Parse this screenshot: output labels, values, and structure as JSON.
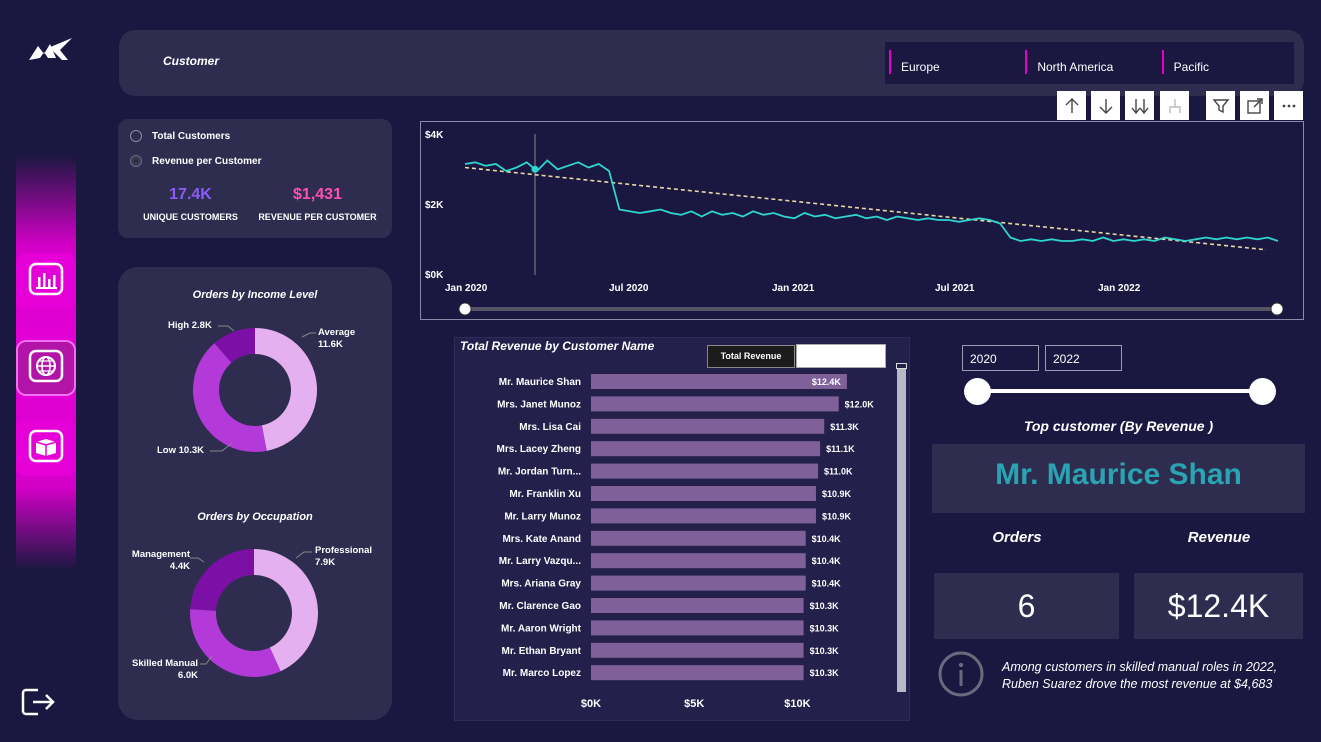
{
  "header": {
    "title": "Customer"
  },
  "region_slicer": {
    "items": [
      "Europe",
      "North America",
      "Pacific"
    ]
  },
  "kpi": {
    "options": [
      "Total Customers",
      "Revenue per Customer"
    ],
    "selected_option": "Revenue per Customer",
    "unique_customers_value": "17.4K",
    "unique_customers_label": "UNIQUE CUSTOMERS",
    "revenue_per_customer_value": "$1,431",
    "revenue_per_customer_label": "REVENUE PER CUSTOMER",
    "unique_color": "#8b5cf6",
    "revenue_color": "#ff4fb4"
  },
  "line_chart": {
    "y_ticks": [
      "$4K",
      "$2K",
      "$0K"
    ],
    "x_ticks": [
      "Jan 2020",
      "Jul 2020",
      "Jan 2021",
      "Jul 2021",
      "Jan 2022"
    ],
    "line_color": "#2fd5cf",
    "trend_color": "#e7d8a4"
  },
  "donut_income": {
    "title": "Orders by Income Level",
    "labels": [
      {
        "name": "Average",
        "value": "11.6K"
      },
      {
        "name": "Low",
        "value": "10.3K"
      },
      {
        "name": "High",
        "value": "2.8K"
      }
    ],
    "colors": [
      "#e4b0f0",
      "#b339d9",
      "#7b0fa6"
    ]
  },
  "donut_occupation": {
    "title": "Orders by Occupation",
    "labels": [
      {
        "name": "Professional",
        "value": "7.9K"
      },
      {
        "name": "Skilled Manual",
        "value": "6.0K"
      },
      {
        "name": "Management",
        "value": "4.4K"
      }
    ],
    "colors": [
      "#e4b0f0",
      "#b339d9",
      "#7b0fa6"
    ]
  },
  "bar_chart": {
    "title": "Total Revenue by Customer Name",
    "legend_button": "Total Revenue",
    "x_ticks": [
      "$0K",
      "$5K",
      "$10K"
    ],
    "bar_color": "#7f6099",
    "rows": [
      {
        "name": "Mr. Maurice Shan",
        "label": "$12.4K"
      },
      {
        "name": "Mrs. Janet Munoz",
        "label": "$12.0K"
      },
      {
        "name": "Mrs. Lisa Cai",
        "label": "$11.3K"
      },
      {
        "name": "Mrs. Lacey Zheng",
        "label": "$11.1K"
      },
      {
        "name": "Mr. Jordan Turn...",
        "label": "$11.0K"
      },
      {
        "name": "Mr. Franklin Xu",
        "label": "$10.9K"
      },
      {
        "name": "Mr. Larry Munoz",
        "label": "$10.9K"
      },
      {
        "name": "Mrs. Kate Anand",
        "label": "$10.4K"
      },
      {
        "name": "Mr. Larry Vazqu...",
        "label": "$10.4K"
      },
      {
        "name": "Mrs. Ariana Gray",
        "label": "$10.4K"
      },
      {
        "name": "Mr. Clarence Gao",
        "label": "$10.3K"
      },
      {
        "name": "Mr. Aaron Wright",
        "label": "$10.3K"
      },
      {
        "name": "Mr. Ethan Bryant",
        "label": "$10.3K"
      },
      {
        "name": "Mr. Marco Lopez",
        "label": "$10.3K"
      }
    ]
  },
  "chart_data": [
    {
      "type": "line",
      "title": "",
      "xlabel": "",
      "ylabel": "",
      "x_range": [
        "Jan 2020",
        "May 2022"
      ],
      "ylim": [
        0,
        4000
      ],
      "series": [
        {
          "values": [
            3200,
            3250,
            3150,
            3200,
            3000,
            3100,
            3250,
            3000,
            3300,
            3050,
            3150,
            3250,
            3100,
            3200,
            3000,
            1900,
            1850,
            1800,
            1850,
            1900,
            1800,
            1750,
            1850,
            1700,
            1850,
            1750,
            1800,
            1700,
            1850,
            1750,
            1800,
            1700,
            1650,
            1800,
            1700,
            1750,
            1650,
            1700,
            1750,
            1650,
            1700,
            1600,
            1700,
            1650,
            1600,
            1650,
            1600,
            1600,
            1550,
            1600,
            1650,
            1600,
            1500,
            1100,
            1000,
            1050,
            1000,
            1050,
            1000,
            1000,
            1050,
            1000,
            1100,
            1000,
            1050,
            1000,
            1050,
            1000,
            1100,
            1050,
            1000,
            1050,
            1100,
            1050,
            1100,
            1050,
            1100,
            1050,
            1100,
            1000
          ]
        },
        {
          "name": "",
          "values": [
            3100,
            750
          ]
        }
      ]
    },
    {
      "type": "pie",
      "title": "Orders by Income Level",
      "categories": [
        "Average",
        "Low",
        "High"
      ],
      "values": [
        11600,
        10300,
        2800
      ]
    },
    {
      "type": "pie",
      "title": "Orders by Occupation",
      "categories": [
        "Professional",
        "Skilled Manual",
        "Management"
      ],
      "values": [
        7900,
        6000,
        4400
      ]
    },
    {
      "type": "bar",
      "title": "Total Revenue by Customer Name",
      "categories": [
        "Mr. Maurice Shan",
        "Mrs. Janet Munoz",
        "Mrs. Lisa Cai",
        "Mrs. Lacey Zheng",
        "Mr. Jordan Turn...",
        "Mr. Franklin Xu",
        "Mr. Larry Munoz",
        "Mrs. Kate Anand",
        "Mr. Larry Vazqu...",
        "Mrs. Ariana Gray",
        "Mr. Clarence Gao",
        "Mr. Aaron Wright",
        "Mr. Ethan Bryant",
        "Mr. Marco Lopez"
      ],
      "values": [
        12400,
        12000,
        11300,
        11100,
        11000,
        10900,
        10900,
        10400,
        10400,
        10400,
        10300,
        10300,
        10300,
        10300
      ],
      "xlim": [
        0,
        12500
      ]
    }
  ],
  "year_slicer": {
    "start": "2020",
    "end": "2022"
  },
  "top_customer": {
    "title": "Top customer (By Revenue )",
    "name": "Mr. Maurice Shan",
    "orders_label": "Orders",
    "revenue_label": "Revenue",
    "orders_value": "6",
    "revenue_value": "$12.4K",
    "name_color": "#2aa3b3"
  },
  "insight": {
    "line1": "Among customers in skilled manual roles in 2022,",
    "line2": "Ruben Suarez drove the most revenue at $4,683"
  },
  "icons": [
    "logo-icon",
    "chart-icon",
    "globe-icon",
    "box-icon",
    "exit-icon",
    "info-icon"
  ]
}
